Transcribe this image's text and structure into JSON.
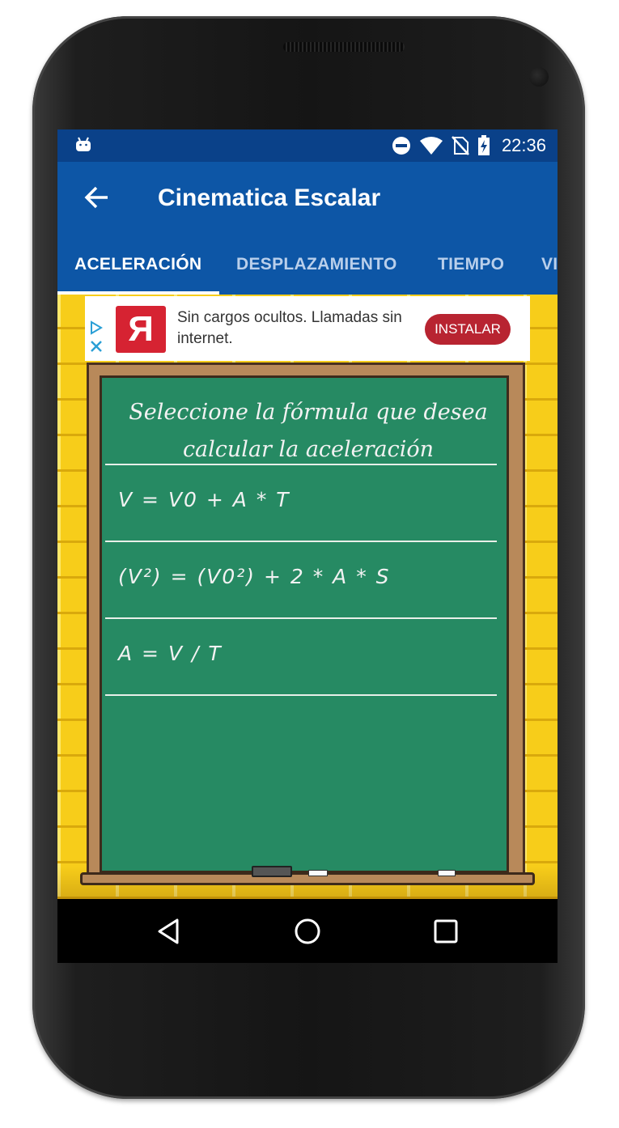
{
  "status_bar": {
    "time": "22:36",
    "icons": [
      "android-debug-icon",
      "do-not-disturb-icon",
      "wifi-icon",
      "no-sim-icon",
      "battery-charging-icon"
    ]
  },
  "app_bar": {
    "title": "Cinematica Escalar",
    "back_icon": "arrow-back-icon"
  },
  "tabs": [
    {
      "label": "ACELERACIÓN",
      "active": true
    },
    {
      "label": "DESPLAZAMIENTO",
      "active": false
    },
    {
      "label": "TIEMPO",
      "active": false
    },
    {
      "label": "VI",
      "active": false
    }
  ],
  "ad": {
    "logo_letter": "R",
    "text": "Sin cargos ocultos. Llamadas sin internet.",
    "button": "INSTALAR"
  },
  "board": {
    "prompt": "Seleccione la fórmula que desea calcular la aceleración",
    "formulas": [
      "V = V0 + A * T",
      "(V²) = (V0²) + 2 * A * S",
      "A = V / T"
    ]
  },
  "colors": {
    "status_bar": "#0a4189",
    "app_bar": "#0d56a6",
    "board": "#268a63",
    "wall": "#f7cd1a",
    "install_button": "#b82431"
  }
}
